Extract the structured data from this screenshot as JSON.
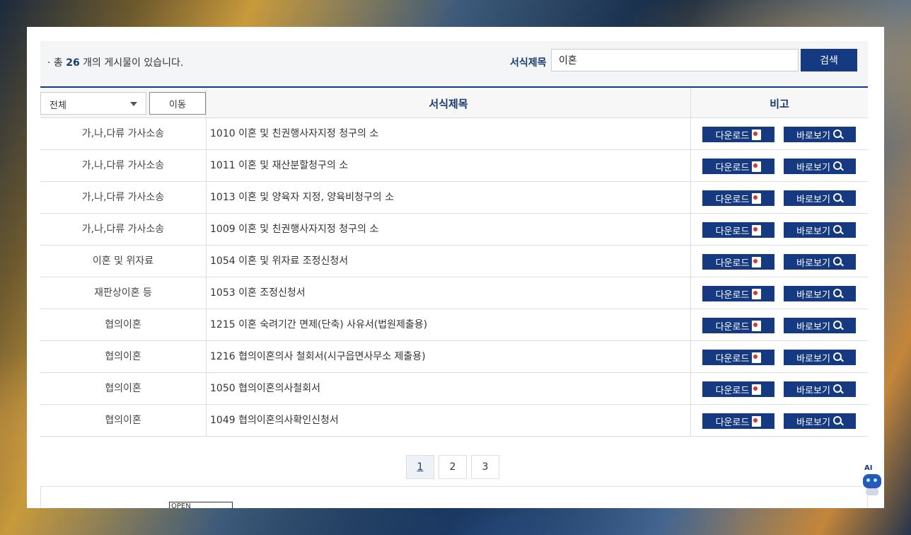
{
  "summary": {
    "prefix": "· 총 ",
    "count": "26",
    "suffix": " 개의 게시물이 있습니다."
  },
  "search": {
    "label": "서식제목",
    "value": "이혼",
    "button": "검색"
  },
  "filter": {
    "selected": "전체",
    "move_button": "이동"
  },
  "table": {
    "headers": {
      "title": "서식제목",
      "note": "비고"
    },
    "download_label": "다운로드",
    "view_label": "바로보기",
    "rows": [
      {
        "category": "가,나,다류 가사소송",
        "title": "1010 이혼 및 친권행사자지정 청구의 소"
      },
      {
        "category": "가,나,다류 가사소송",
        "title": "1011 이혼 및 재산분할청구의 소"
      },
      {
        "category": "가,나,다류 가사소송",
        "title": "1013 이혼 및 양육자 지정, 양육비청구의 소"
      },
      {
        "category": "가,나,다류 가사소송",
        "title": "1009 이혼 및 친권행사자지정 청구의 소"
      },
      {
        "category": "이혼 및 위자료",
        "title": "1054 이혼 및 위자료 조정신청서"
      },
      {
        "category": "재판상이혼 등",
        "title": "1053 이혼 조정신청서"
      },
      {
        "category": "협의이혼",
        "title": "1215 이혼 숙려기간 면제(단축) 사유서(법원제출용)"
      },
      {
        "category": "협의이혼",
        "title": "1216 협의이혼의사 철회서(시구읍면사무소 제출용)"
      },
      {
        "category": "협의이혼",
        "title": "1050 협의이혼의사철회서"
      },
      {
        "category": "협의이혼",
        "title": "1049 협의이혼의사확인신청서"
      }
    ]
  },
  "pagination": [
    "1",
    "2",
    "3"
  ],
  "footer": {
    "badge": "OPEN"
  },
  "ai": {
    "label": "AI"
  },
  "colors": {
    "primary": "#163a82",
    "accent": "#1a3a70"
  }
}
